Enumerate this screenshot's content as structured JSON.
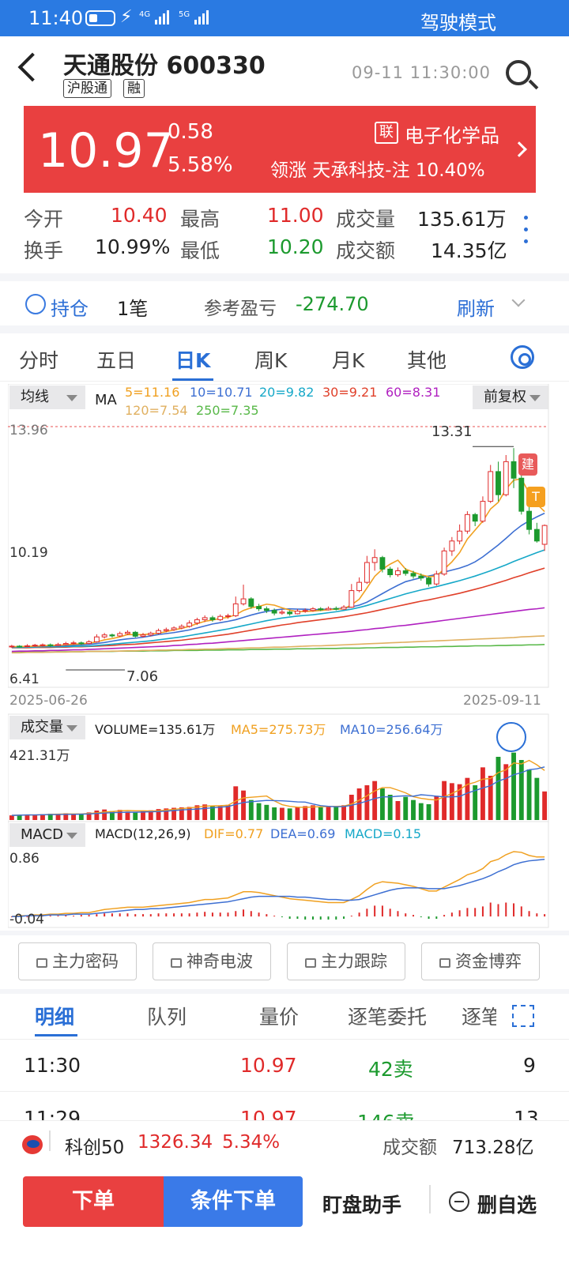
{
  "status_bar": {
    "time": "11:40",
    "net1": "4G",
    "net2": "5G",
    "mode": "驾驶模式"
  },
  "header": {
    "title": "天通股份 600330",
    "tags": [
      "沪股通",
      "融"
    ],
    "time": "09-11 11:30:00"
  },
  "quote": {
    "price": "10.97",
    "change": "0.58",
    "change_pct": "5.58%",
    "sector_tag": "联",
    "sector": "电子化学品",
    "lead": "领涨 天承科技-注 10.40%"
  },
  "stats": [
    [
      {
        "label": "今开",
        "value": "10.40"
      },
      {
        "label": "最高",
        "value": "11.00"
      },
      {
        "label": "成交量",
        "value": "135.61万"
      }
    ],
    [
      {
        "label": "换手",
        "value": "10.99%"
      },
      {
        "label": "最低",
        "value": "10.20"
      },
      {
        "label": "成交额",
        "value": "14.35亿"
      }
    ]
  ],
  "holding": {
    "label": "持仓",
    "count": "1笔",
    "pnl_label": "参考盈亏",
    "pnl": "-274.70",
    "refresh": "刷新"
  },
  "period_tabs": [
    "分时",
    "五日",
    "日K",
    "周K",
    "月K",
    "其他"
  ],
  "kline": {
    "ma_select": "均线",
    "ma_name": "MA",
    "ma5": "5=11.16",
    "ma10": "10=10.71",
    "ma20": "20=9.82",
    "ma30": "30=9.21",
    "ma60": "60=8.31",
    "ma120": "120=7.54",
    "ma250": "250=7.35",
    "adjust": "前复权",
    "y_top": "13.96",
    "y_mid": "10.19",
    "y_bot": "6.41",
    "high_mark": "13.31",
    "low_mark": "7.06",
    "date_start": "2025-06-26",
    "date_end": "2025-09-11",
    "sig_build": "建",
    "sig_t": "T"
  },
  "volume": {
    "select": "成交量",
    "vol": "VOLUME=135.61万",
    "ma5": "MA5=275.73万",
    "ma10": "MA10=256.64万",
    "y_top": "421.31万"
  },
  "macd": {
    "select": "MACD",
    "name": "MACD(12,26,9)",
    "dif": "DIF=0.77",
    "dea": "DEA=0.69",
    "macd": "MACD=0.15",
    "y_top": "0.86",
    "y_bot": "-0.04"
  },
  "feature_buttons": [
    "主力密码",
    "神奇电波",
    "主力跟踪",
    "资金博弈"
  ],
  "detail_tabs": [
    "明细",
    "队列",
    "量价",
    "逐笔委托",
    "逐笔"
  ],
  "ticks": [
    {
      "time": "11:30",
      "price": "10.97",
      "vol": "42卖",
      "num": "9"
    },
    {
      "time": "11:29",
      "price": "10.97",
      "vol": "146卖",
      "num": "13"
    }
  ],
  "index_bar": {
    "name": "科创50",
    "value": "1326.34",
    "pct": "5.34%",
    "amount_label": "成交额",
    "amount": "713.28亿"
  },
  "actions": {
    "order": "下单",
    "cond_order": "条件下单",
    "assistant": "盯盘助手",
    "remove": "删自选"
  },
  "colors": {
    "up": "#e02a2a",
    "down": "#1c9a2e",
    "accent": "#2a6fd6",
    "price_bg": "#e94040"
  },
  "chart_data": {
    "type": "candlestick",
    "x_range": [
      "2025-06-26",
      "2025-09-11"
    ],
    "y_range": [
      6.41,
      13.96
    ],
    "candles": [
      [
        7.3,
        7.32,
        7.36,
        7.27
      ],
      [
        7.32,
        7.31,
        7.35,
        7.28
      ],
      [
        7.31,
        7.33,
        7.38,
        7.29
      ],
      [
        7.33,
        7.35,
        7.39,
        7.3
      ],
      [
        7.35,
        7.36,
        7.4,
        7.31
      ],
      [
        7.36,
        7.34,
        7.4,
        7.3
      ],
      [
        7.34,
        7.37,
        7.42,
        7.32
      ],
      [
        7.37,
        7.4,
        7.45,
        7.35
      ],
      [
        7.4,
        7.42,
        7.48,
        7.37
      ],
      [
        7.42,
        7.4,
        7.46,
        7.36
      ],
      [
        7.4,
        7.45,
        7.5,
        7.38
      ],
      [
        7.45,
        7.6,
        7.68,
        7.43
      ],
      [
        7.6,
        7.66,
        7.72,
        7.55
      ],
      [
        7.66,
        7.63,
        7.7,
        7.58
      ],
      [
        7.63,
        7.7,
        7.76,
        7.6
      ],
      [
        7.7,
        7.74,
        7.8,
        7.66
      ],
      [
        7.74,
        7.62,
        7.78,
        7.58
      ],
      [
        7.62,
        7.66,
        7.72,
        7.58
      ],
      [
        7.66,
        7.71,
        7.76,
        7.62
      ],
      [
        7.71,
        7.79,
        7.85,
        7.68
      ],
      [
        7.79,
        7.82,
        7.88,
        7.74
      ],
      [
        7.82,
        7.87,
        7.92,
        7.78
      ],
      [
        7.87,
        7.92,
        7.98,
        7.83
      ],
      [
        7.92,
        8.02,
        8.1,
        7.88
      ],
      [
        8.02,
        8.12,
        8.18,
        7.96
      ],
      [
        8.12,
        8.18,
        8.25,
        8.05
      ],
      [
        8.18,
        8.12,
        8.24,
        8.06
      ],
      [
        8.12,
        8.22,
        8.28,
        8.08
      ],
      [
        8.22,
        8.24,
        8.3,
        8.15
      ],
      [
        8.24,
        8.6,
        8.82,
        8.2
      ],
      [
        8.6,
        8.75,
        9.18,
        8.55
      ],
      [
        8.75,
        8.52,
        8.8,
        8.45
      ],
      [
        8.52,
        8.45,
        8.6,
        8.38
      ],
      [
        8.45,
        8.4,
        8.52,
        8.32
      ],
      [
        8.4,
        8.32,
        8.46,
        8.25
      ],
      [
        8.32,
        8.35,
        8.42,
        8.27
      ],
      [
        8.35,
        8.3,
        8.4,
        8.24
      ],
      [
        8.3,
        8.38,
        8.44,
        8.28
      ],
      [
        8.38,
        8.4,
        8.46,
        8.33
      ],
      [
        8.4,
        8.45,
        8.5,
        8.36
      ],
      [
        8.45,
        8.42,
        8.5,
        8.38
      ],
      [
        8.42,
        8.46,
        8.52,
        8.4
      ],
      [
        8.46,
        8.44,
        8.52,
        8.4
      ],
      [
        8.44,
        8.5,
        8.56,
        8.42
      ],
      [
        8.5,
        9.0,
        9.2,
        8.48
      ],
      [
        9.0,
        9.25,
        9.4,
        8.95
      ],
      [
        9.25,
        9.85,
        10.05,
        9.2
      ],
      [
        9.85,
        10.0,
        10.25,
        9.6
      ],
      [
        10.0,
        9.65,
        10.05,
        9.55
      ],
      [
        9.65,
        9.48,
        9.72,
        9.4
      ],
      [
        9.48,
        9.6,
        9.7,
        9.42
      ],
      [
        9.6,
        9.52,
        9.68,
        9.45
      ],
      [
        9.52,
        9.44,
        9.6,
        9.36
      ],
      [
        9.44,
        9.38,
        9.52,
        9.3
      ],
      [
        9.38,
        9.2,
        9.42,
        9.12
      ],
      [
        9.2,
        9.5,
        9.6,
        9.15
      ],
      [
        9.5,
        10.2,
        10.3,
        9.45
      ],
      [
        10.2,
        10.5,
        10.62,
        10.05
      ],
      [
        10.5,
        10.8,
        11.0,
        10.4
      ],
      [
        10.8,
        11.3,
        11.4,
        10.72
      ],
      [
        11.3,
        11.1,
        11.35,
        10.95
      ],
      [
        11.1,
        11.7,
        11.85,
        11.05
      ],
      [
        11.7,
        12.6,
        12.8,
        11.65
      ],
      [
        12.6,
        11.9,
        12.9,
        11.7
      ],
      [
        11.9,
        12.9,
        13.1,
        11.85
      ],
      [
        12.9,
        12.4,
        13.31,
        12.1
      ],
      [
        12.4,
        11.4,
        12.55,
        11.3
      ],
      [
        11.4,
        10.85,
        11.55,
        10.7
      ],
      [
        10.85,
        10.5,
        11.05,
        10.45
      ],
      [
        10.4,
        10.97,
        11.0,
        10.2
      ]
    ],
    "ma_lines": {
      "MA5": [
        7.3,
        7.31,
        7.31,
        7.32,
        7.33,
        7.34,
        7.35,
        7.36,
        7.38,
        7.39,
        7.41,
        7.45,
        7.51,
        7.55,
        7.6,
        7.67,
        7.67,
        7.67,
        7.69,
        7.71,
        7.76,
        7.81,
        7.86,
        7.92,
        8.0,
        8.07,
        8.11,
        8.16,
        8.19,
        8.27,
        8.4,
        8.48,
        8.52,
        8.59,
        8.56,
        8.48,
        8.41,
        8.36,
        8.37,
        8.38,
        8.4,
        8.42,
        8.44,
        8.45,
        8.57,
        8.74,
        9.08,
        9.43,
        9.65,
        9.8,
        9.92,
        9.65,
        9.56,
        9.48,
        9.42,
        9.44,
        9.65,
        9.87,
        10.15,
        10.56,
        10.83,
        11.1,
        11.47,
        11.67,
        12.07,
        12.34,
        12.38,
        11.95,
        11.62,
        11.39
      ],
      "MA10": [
        7.3,
        7.3,
        7.31,
        7.31,
        7.32,
        7.33,
        7.33,
        7.34,
        7.35,
        7.36,
        7.37,
        7.4,
        7.43,
        7.47,
        7.51,
        7.54,
        7.56,
        7.59,
        7.63,
        7.67,
        7.7,
        7.73,
        7.77,
        7.81,
        7.87,
        7.93,
        7.99,
        8.03,
        8.07,
        8.12,
        8.19,
        8.26,
        8.32,
        8.37,
        8.41,
        8.44,
        8.45,
        8.44,
        8.44,
        8.42,
        8.43,
        8.44,
        8.45,
        8.47,
        8.51,
        8.56,
        8.65,
        8.78,
        8.91,
        9.04,
        9.16,
        9.27,
        9.33,
        9.39,
        9.44,
        9.49,
        9.56,
        9.62,
        9.68,
        9.76,
        9.87,
        10.02,
        10.2,
        10.38,
        10.58,
        10.79,
        10.97,
        11.11,
        11.23,
        11.34
      ],
      "MA20": [
        7.28,
        7.28,
        7.29,
        7.29,
        7.3,
        7.3,
        7.3,
        7.31,
        7.31,
        7.32,
        7.32,
        7.34,
        7.36,
        7.38,
        7.4,
        7.42,
        7.44,
        7.46,
        7.48,
        7.51,
        7.54,
        7.57,
        7.6,
        7.64,
        7.68,
        7.72,
        7.76,
        7.8,
        7.84,
        7.89,
        7.94,
        7.99,
        8.04,
        8.09,
        8.13,
        8.17,
        8.2,
        8.23,
        8.25,
        8.27,
        8.3,
        8.33,
        8.36,
        8.4,
        8.44,
        8.49,
        8.55,
        8.62,
        8.69,
        8.76,
        8.83,
        8.9,
        8.96,
        9.02,
        9.07,
        9.12,
        9.18,
        9.24,
        9.3,
        9.37,
        9.44,
        9.52,
        9.6,
        9.69,
        9.78,
        9.88,
        9.97,
        10.06,
        10.15,
        10.23
      ],
      "MA30": [
        7.27,
        7.27,
        7.27,
        7.28,
        7.28,
        7.28,
        7.29,
        7.29,
        7.3,
        7.3,
        7.31,
        7.32,
        7.33,
        7.34,
        7.36,
        7.37,
        7.38,
        7.4,
        7.42,
        7.44,
        7.46,
        7.48,
        7.5,
        7.53,
        7.56,
        7.59,
        7.62,
        7.65,
        7.68,
        7.72,
        7.76,
        7.8,
        7.84,
        7.88,
        7.92,
        7.96,
        7.99,
        8.03,
        8.06,
        8.09,
        8.12,
        8.15,
        8.18,
        8.21,
        8.25,
        8.29,
        8.33,
        8.38,
        8.43,
        8.48,
        8.53,
        8.58,
        8.63,
        8.68,
        8.72,
        8.77,
        8.82,
        8.87,
        8.92,
        8.98,
        9.04,
        9.1,
        9.17,
        9.24,
        9.31,
        9.39,
        9.46,
        9.54,
        9.61,
        9.68
      ],
      "MA60": [
        7.16,
        7.17,
        7.17,
        7.18,
        7.18,
        7.19,
        7.19,
        7.2,
        7.21,
        7.21,
        7.22,
        7.23,
        7.24,
        7.25,
        7.26,
        7.27,
        7.28,
        7.29,
        7.3,
        7.31,
        7.32,
        7.34,
        7.35,
        7.37,
        7.38,
        7.4,
        7.41,
        7.43,
        7.45,
        7.47,
        7.49,
        7.51,
        7.53,
        7.55,
        7.57,
        7.59,
        7.61,
        7.63,
        7.65,
        7.67,
        7.69,
        7.71,
        7.73,
        7.75,
        7.77,
        7.8,
        7.82,
        7.85,
        7.87,
        7.9,
        7.93,
        7.95,
        7.98,
        8.01,
        8.04,
        8.07,
        8.1,
        8.13,
        8.16,
        8.19,
        8.22,
        8.25,
        8.28,
        8.31,
        8.34,
        8.37,
        8.4,
        8.43,
        8.45,
        8.48
      ],
      "MA120": [
        7.12,
        7.12,
        7.13,
        7.13,
        7.13,
        7.14,
        7.14,
        7.14,
        7.15,
        7.15,
        7.16,
        7.16,
        7.16,
        7.17,
        7.17,
        7.18,
        7.18,
        7.19,
        7.19,
        7.2,
        7.2,
        7.21,
        7.21,
        7.22,
        7.22,
        7.23,
        7.23,
        7.24,
        7.25,
        7.25,
        7.26,
        7.27,
        7.27,
        7.28,
        7.29,
        7.29,
        7.3,
        7.31,
        7.32,
        7.33,
        7.33,
        7.34,
        7.35,
        7.36,
        7.37,
        7.38,
        7.39,
        7.4,
        7.41,
        7.42,
        7.43,
        7.44,
        7.45,
        7.46,
        7.47,
        7.48,
        7.49,
        7.5,
        7.51,
        7.52,
        7.53,
        7.54,
        7.55,
        7.56,
        7.57,
        7.58,
        7.6,
        7.61,
        7.62,
        7.63
      ],
      "MA250": [
        7.13,
        7.13,
        7.14,
        7.14,
        7.14,
        7.14,
        7.15,
        7.15,
        7.15,
        7.15,
        7.16,
        7.16,
        7.16,
        7.16,
        7.17,
        7.17,
        7.17,
        7.17,
        7.18,
        7.18,
        7.18,
        7.19,
        7.19,
        7.19,
        7.19,
        7.2,
        7.2,
        7.2,
        7.21,
        7.21,
        7.21,
        7.22,
        7.22,
        7.22,
        7.23,
        7.23,
        7.23,
        7.24,
        7.24,
        7.24,
        7.25,
        7.25,
        7.25,
        7.26,
        7.26,
        7.26,
        7.27,
        7.27,
        7.28,
        7.28,
        7.28,
        7.29,
        7.29,
        7.3,
        7.3,
        7.3,
        7.31,
        7.31,
        7.32,
        7.32,
        7.33,
        7.33,
        7.33,
        7.34,
        7.34,
        7.35,
        7.35,
        7.36,
        7.36,
        7.37
      ]
    },
    "volume": [
      22,
      24,
      26,
      25,
      28,
      30,
      27,
      32,
      30,
      28,
      36,
      45,
      50,
      42,
      48,
      40,
      38,
      42,
      46,
      52,
      55,
      58,
      60,
      62,
      70,
      74,
      68,
      66,
      72,
      160,
      140,
      95,
      80,
      72,
      60,
      58,
      55,
      62,
      66,
      70,
      60,
      64,
      66,
      70,
      120,
      150,
      165,
      185,
      150,
      120,
      90,
      110,
      95,
      80,
      75,
      115,
      185,
      175,
      170,
      200,
      165,
      250,
      210,
      300,
      265,
      320,
      285,
      240,
      200,
      135.61
    ],
    "vol_ma5": [
      22,
      23,
      24,
      24,
      25,
      27,
      28,
      29,
      29,
      29,
      31,
      34,
      38,
      40,
      44,
      45,
      44,
      44,
      43,
      44,
      47,
      51,
      54,
      58,
      61,
      66,
      67,
      68,
      70,
      90,
      105,
      108,
      111,
      114,
      91,
      73,
      65,
      61,
      60,
      62,
      63,
      64,
      65,
      66,
      76,
      94,
      115,
      138,
      154,
      154,
      142,
      129,
      111,
      103,
      98,
      95,
      110,
      126,
      144,
      169,
      179,
      194,
      197,
      225,
      238,
      271,
      266,
      283,
      262,
      235
    ],
    "vol_ma10": [
      22,
      23,
      24,
      24,
      25,
      26,
      26,
      27,
      27,
      28,
      29,
      31,
      33,
      35,
      36,
      37,
      37,
      38,
      39,
      40,
      42,
      45,
      48,
      50,
      52,
      55,
      58,
      61,
      64,
      74,
      83,
      87,
      90,
      93,
      92,
      91,
      89,
      86,
      85,
      76,
      68,
      65,
      63,
      64,
      70,
      79,
      90,
      102,
      110,
      110,
      113,
      115,
      113,
      120,
      117,
      113,
      110,
      110,
      112,
      128,
      140,
      152,
      163,
      185,
      197,
      215,
      225,
      239,
      243,
      252
    ],
    "dif": [
      0.0,
      0.01,
      0.01,
      0.02,
      0.02,
      0.03,
      0.03,
      0.04,
      0.04,
      0.05,
      0.05,
      0.07,
      0.09,
      0.1,
      0.11,
      0.12,
      0.12,
      0.12,
      0.13,
      0.14,
      0.15,
      0.16,
      0.17,
      0.18,
      0.2,
      0.22,
      0.22,
      0.23,
      0.24,
      0.28,
      0.32,
      0.32,
      0.31,
      0.29,
      0.27,
      0.25,
      0.23,
      0.22,
      0.21,
      0.2,
      0.19,
      0.18,
      0.18,
      0.18,
      0.22,
      0.27,
      0.35,
      0.42,
      0.45,
      0.44,
      0.43,
      0.41,
      0.39,
      0.36,
      0.33,
      0.33,
      0.38,
      0.43,
      0.48,
      0.54,
      0.57,
      0.62,
      0.71,
      0.74,
      0.8,
      0.84,
      0.83,
      0.79,
      0.77,
      0.77
    ],
    "dea": [
      0.0,
      0.0,
      0.01,
      0.01,
      0.01,
      0.02,
      0.02,
      0.02,
      0.03,
      0.03,
      0.03,
      0.04,
      0.05,
      0.06,
      0.07,
      0.08,
      0.09,
      0.09,
      0.1,
      0.1,
      0.11,
      0.12,
      0.13,
      0.14,
      0.15,
      0.16,
      0.17,
      0.18,
      0.19,
      0.21,
      0.23,
      0.25,
      0.26,
      0.26,
      0.26,
      0.26,
      0.26,
      0.25,
      0.25,
      0.24,
      0.23,
      0.22,
      0.22,
      0.21,
      0.21,
      0.22,
      0.25,
      0.28,
      0.31,
      0.34,
      0.36,
      0.37,
      0.37,
      0.37,
      0.36,
      0.36,
      0.36,
      0.38,
      0.4,
      0.43,
      0.46,
      0.49,
      0.53,
      0.58,
      0.62,
      0.67,
      0.7,
      0.72,
      0.73,
      0.74
    ],
    "macd_hist": [
      0.0,
      0.01,
      0.0,
      0.01,
      0.01,
      0.01,
      0.01,
      0.02,
      0.01,
      0.02,
      0.02,
      0.03,
      0.04,
      0.04,
      0.04,
      0.04,
      0.03,
      0.03,
      0.03,
      0.04,
      0.04,
      0.04,
      0.04,
      0.04,
      0.05,
      0.06,
      0.05,
      0.05,
      0.05,
      0.07,
      0.09,
      0.07,
      0.05,
      0.03,
      0.01,
      -0.01,
      -0.03,
      -0.03,
      -0.04,
      -0.04,
      -0.04,
      -0.04,
      -0.04,
      -0.03,
      0.01,
      0.05,
      0.1,
      0.14,
      0.14,
      0.1,
      0.07,
      0.04,
      0.02,
      -0.01,
      -0.03,
      -0.03,
      0.02,
      0.05,
      0.08,
      0.11,
      0.11,
      0.13,
      0.18,
      0.16,
      0.18,
      0.17,
      0.13,
      0.07,
      0.04,
      0.03
    ]
  }
}
